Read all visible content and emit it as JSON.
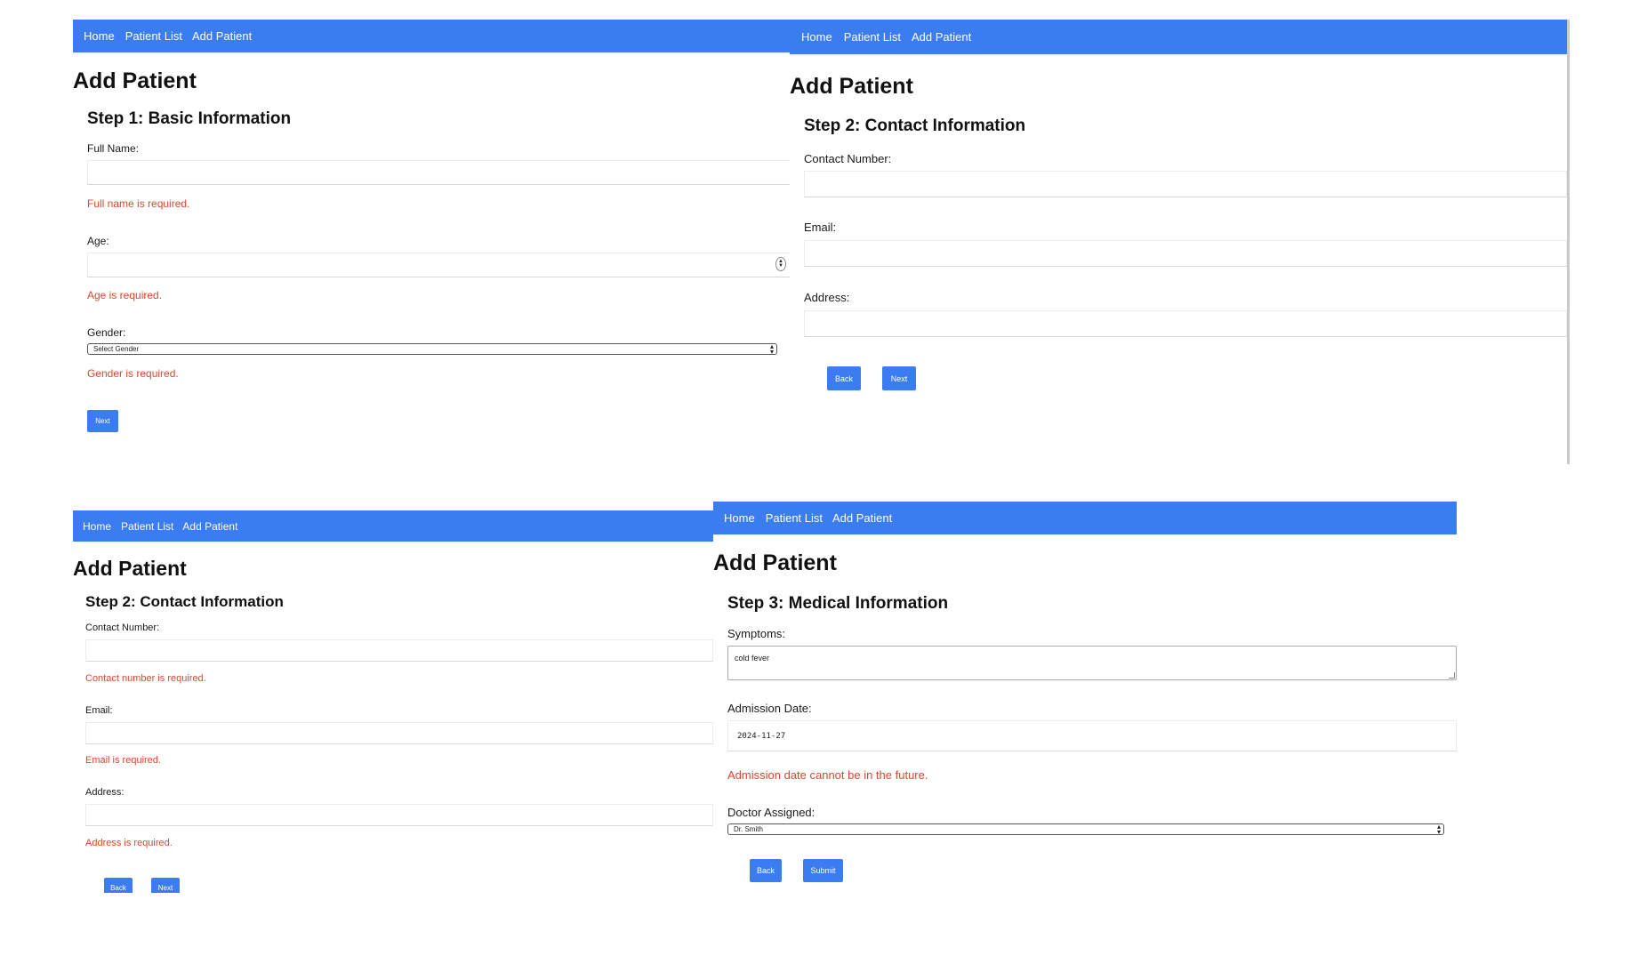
{
  "nav": {
    "home": "Home",
    "patient_list": "Patient List",
    "add_patient": "Add Patient"
  },
  "page_title": "Add Patient",
  "panel1": {
    "step_title": "Step 1: Basic Information",
    "full_name_label": "Full Name:",
    "full_name_value": "",
    "full_name_error": "Full name is required.",
    "age_label": "Age:",
    "age_value": "",
    "age_error": "Age is required.",
    "gender_label": "Gender:",
    "gender_selected": "Select Gender",
    "gender_error": "Gender is required.",
    "next_label": "Next"
  },
  "panel2": {
    "step_title": "Step 2: Contact Information",
    "contact_label": "Contact Number:",
    "email_label": "Email:",
    "address_label": "Address:",
    "back_label": "Back",
    "next_label": "Next"
  },
  "panel3": {
    "step_title": "Step 2: Contact Information",
    "contact_label": "Contact Number:",
    "contact_error": "Contact number is required.",
    "email_label": "Email:",
    "email_error": "Email is required.",
    "address_label": "Address:",
    "address_error": "Address is required.",
    "back_label": "Back",
    "next_label": "Next"
  },
  "panel4": {
    "step_title": "Step 3: Medical Information",
    "symptoms_label": "Symptoms:",
    "symptoms_value": "cold fever",
    "admission_label": "Admission Date:",
    "admission_value": "2024-11-27",
    "admission_error": "Admission date cannot be in the future.",
    "doctor_label": "Doctor Assigned:",
    "doctor_selected": "Dr. Smith",
    "back_label": "Back",
    "submit_label": "Submit"
  },
  "colors": {
    "nav_bg": "#3b7cf0",
    "button_bg": "#3b7cf0",
    "error": "#e0452d"
  }
}
